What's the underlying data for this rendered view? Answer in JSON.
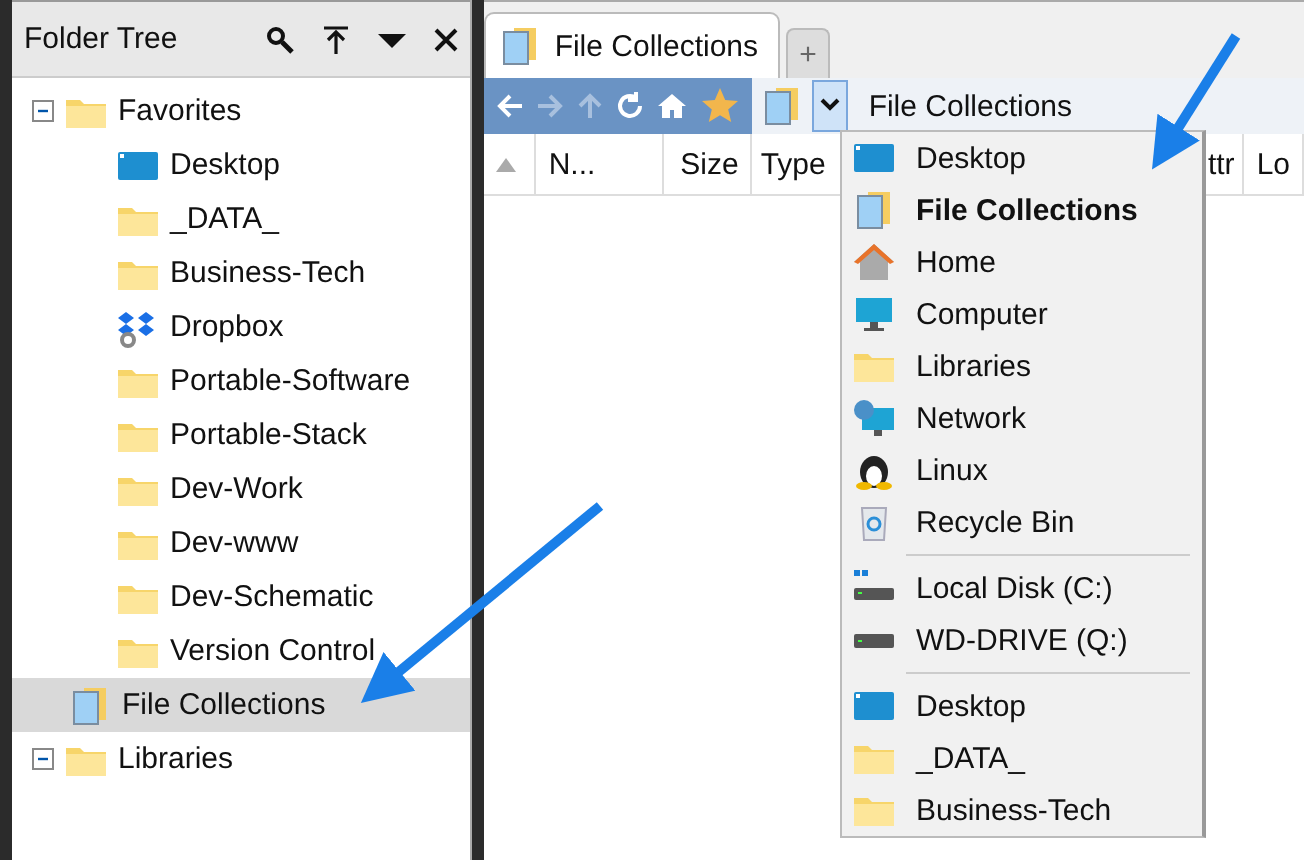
{
  "folder_tree": {
    "title": "Folder Tree",
    "items": [
      {
        "label": "Favorites",
        "kind": "folder",
        "expanded": true,
        "selected": false,
        "children": [
          {
            "label": "Desktop",
            "kind": "desktop",
            "selected": false
          },
          {
            "label": "_DATA_",
            "kind": "folder",
            "selected": false
          },
          {
            "label": "Business-Tech",
            "kind": "folder",
            "selected": false
          },
          {
            "label": "Dropbox",
            "kind": "dropbox",
            "selected": false
          },
          {
            "label": "Portable-Software",
            "kind": "folder",
            "selected": false
          },
          {
            "label": "Portable-Stack",
            "kind": "folder",
            "selected": false
          },
          {
            "label": "Dev-Work",
            "kind": "folder",
            "selected": false
          },
          {
            "label": "Dev-www",
            "kind": "folder",
            "selected": false
          },
          {
            "label": "Dev-Schematic",
            "kind": "folder",
            "selected": false
          },
          {
            "label": "Version Control",
            "kind": "folder",
            "selected": false
          }
        ]
      },
      {
        "label": "File Collections",
        "kind": "collection",
        "selected": true
      },
      {
        "label": "Libraries",
        "kind": "folder",
        "expanded": true,
        "selected": false
      }
    ]
  },
  "tabs": [
    {
      "label": "File Collections",
      "selected": true
    }
  ],
  "new_tab": "+",
  "address": {
    "value": "File Collections"
  },
  "columns": [
    "N...",
    "Size",
    "Type",
    "ttr",
    "Lo"
  ],
  "dropdown": {
    "groups": [
      [
        {
          "label": "Desktop",
          "kind": "desktop",
          "selected": false
        },
        {
          "label": "File Collections",
          "kind": "collection",
          "selected": true
        },
        {
          "label": "Home",
          "kind": "home",
          "selected": false
        },
        {
          "label": "Computer",
          "kind": "computer",
          "selected": false
        },
        {
          "label": "Libraries",
          "kind": "folder",
          "selected": false
        },
        {
          "label": "Network",
          "kind": "network",
          "selected": false
        },
        {
          "label": "Linux",
          "kind": "linux",
          "selected": false
        },
        {
          "label": "Recycle Bin",
          "kind": "bin",
          "selected": false
        }
      ],
      [
        {
          "label": "Local Disk (C:)",
          "kind": "disk",
          "selected": false
        },
        {
          "label": "WD-DRIVE (Q:)",
          "kind": "drive",
          "selected": false
        }
      ],
      [
        {
          "label": "Desktop",
          "kind": "desktop",
          "selected": false
        },
        {
          "label": "_DATA_",
          "kind": "folder",
          "selected": false
        },
        {
          "label": "Business-Tech",
          "kind": "folder",
          "selected": false
        }
      ]
    ]
  }
}
